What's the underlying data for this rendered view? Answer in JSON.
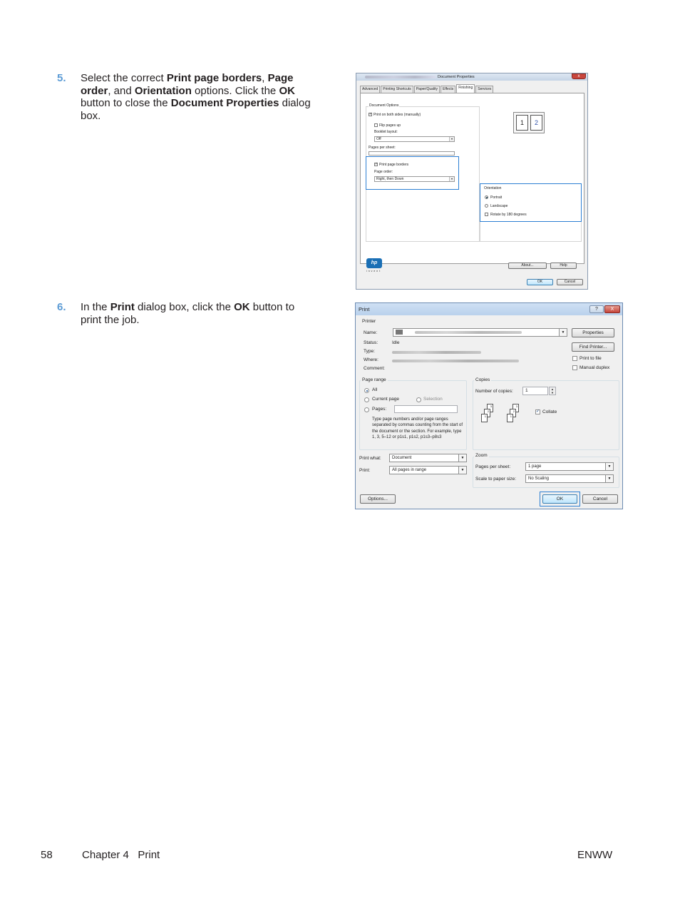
{
  "step5": {
    "number": "5.",
    "t1": "Select the correct ",
    "b1": "Print page borders",
    "t2": ", ",
    "b2": "Page order",
    "t3": ", and ",
    "b3": "Orientation",
    "t4": " options. Click the ",
    "b4": "OK",
    "t5": " button to close the ",
    "b5": "Document Properties",
    "t6": " dialog box."
  },
  "step6": {
    "number": "6.",
    "t1": "In the ",
    "b1": "Print",
    "t2": " dialog box, click the ",
    "b2": "OK",
    "t3": " button to print the job."
  },
  "doc_props": {
    "title": "Document Properties",
    "close": "x",
    "tabs": [
      "Advanced",
      "Printing Shortcuts",
      "Paper/Quality",
      "Effects",
      "Finishing",
      "Services"
    ],
    "active_tab": "Finishing",
    "group_title": "Document Options",
    "print_both_sides": "Print on both sides (manually)",
    "flip_pages_up": "Flip pages up",
    "booklet_layout": "Booklet layout:",
    "booklet_value": "Off",
    "pages_per_sheet": "Pages per sheet:",
    "print_page_borders": "Print page borders",
    "page_order": "Page order:",
    "page_order_value": "Right, then Down",
    "orientation_title": "Orientation",
    "portrait": "Portrait",
    "landscape": "Landscape",
    "rotate": "Rotate by 180 degrees",
    "preview_1": "1",
    "preview_2": "2",
    "hp_logo": "hp",
    "hp_invent": "i n v e n t",
    "about": "About...",
    "help": "Help",
    "ok": "OK",
    "cancel": "Cancel"
  },
  "print_dialog": {
    "title": "Print",
    "help": "?",
    "close": "X",
    "printer_group": "Printer",
    "name_label": "Name:",
    "status_label": "Status:",
    "status_value": "Idle",
    "type_label": "Type:",
    "where_label": "Where:",
    "comment_label": "Comment:",
    "properties": "Properties",
    "find_printer": "Find Printer...",
    "print_to_file": "Print to file",
    "manual_duplex": "Manual duplex",
    "page_range_group": "Page range",
    "all": "All",
    "current_page": "Current page",
    "selection": "Selection",
    "pages": "Pages:",
    "range_help": "Type page numbers and/or page ranges separated by commas counting from the start of the document or the section. For example, type 1, 3, 5–12 or p1s1, p1s2, p1s3–p8s3",
    "copies_group": "Copies",
    "number_of_copies": "Number of copies:",
    "copies_value": "1",
    "collate": "Collate",
    "print_what_label": "Print what:",
    "print_what_value": "Document",
    "print_label": "Print:",
    "print_value": "All pages in range",
    "zoom_group": "Zoom",
    "pages_per_sheet_label": "Pages per sheet:",
    "pages_per_sheet_value": "1 page",
    "scale_label": "Scale to paper size:",
    "scale_value": "No Scaling",
    "options": "Options...",
    "ok": "OK",
    "cancel": "Cancel"
  },
  "footer": {
    "page_number": "58",
    "chapter": "Chapter 4   Print",
    "code": "ENWW"
  }
}
